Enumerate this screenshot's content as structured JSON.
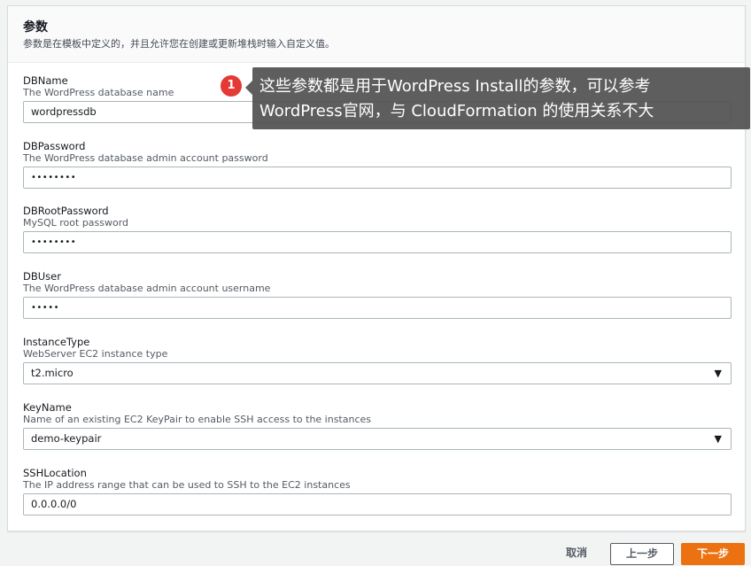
{
  "section": {
    "title": "参数",
    "description": "参数是在模板中定义的，并且允许您在创建或更新堆栈时输入自定义值。"
  },
  "fields": [
    {
      "label": "DBName",
      "description": "The WordPress database name",
      "value": "wordpressdb",
      "type": "text"
    },
    {
      "label": "DBPassword",
      "description": "The WordPress database admin account password",
      "value": "••••••••",
      "type": "password"
    },
    {
      "label": "DBRootPassword",
      "description": "MySQL root password",
      "value": "••••••••",
      "type": "password"
    },
    {
      "label": "DBUser",
      "description": "The WordPress database admin account username",
      "value": "•••••",
      "type": "password"
    },
    {
      "label": "InstanceType",
      "description": "WebServer EC2 instance type",
      "value": "t2.micro",
      "type": "select"
    },
    {
      "label": "KeyName",
      "description": "Name of an existing EC2 KeyPair to enable SSH access to the instances",
      "value": "demo-keypair",
      "type": "select"
    },
    {
      "label": "SSHLocation",
      "description": "The IP address range that can be used to SSH to the EC2 instances",
      "value": "0.0.0.0/0",
      "type": "text"
    }
  ],
  "annotation": {
    "badge": "1",
    "line1": "这些参数都是用于WordPress Install的参数，可以参考",
    "line2": "WordPress官网，与 CloudFormation 的使用关系不大"
  },
  "footer": {
    "cancel_label": "取消",
    "prev_label": "上一步",
    "next_label": "下一步"
  },
  "icons": {
    "dropdown": "caret-down-icon"
  },
  "colors": {
    "primary_button": "#ec7211",
    "annotation_badge": "#e53935",
    "annotation_bg": "#505050"
  }
}
